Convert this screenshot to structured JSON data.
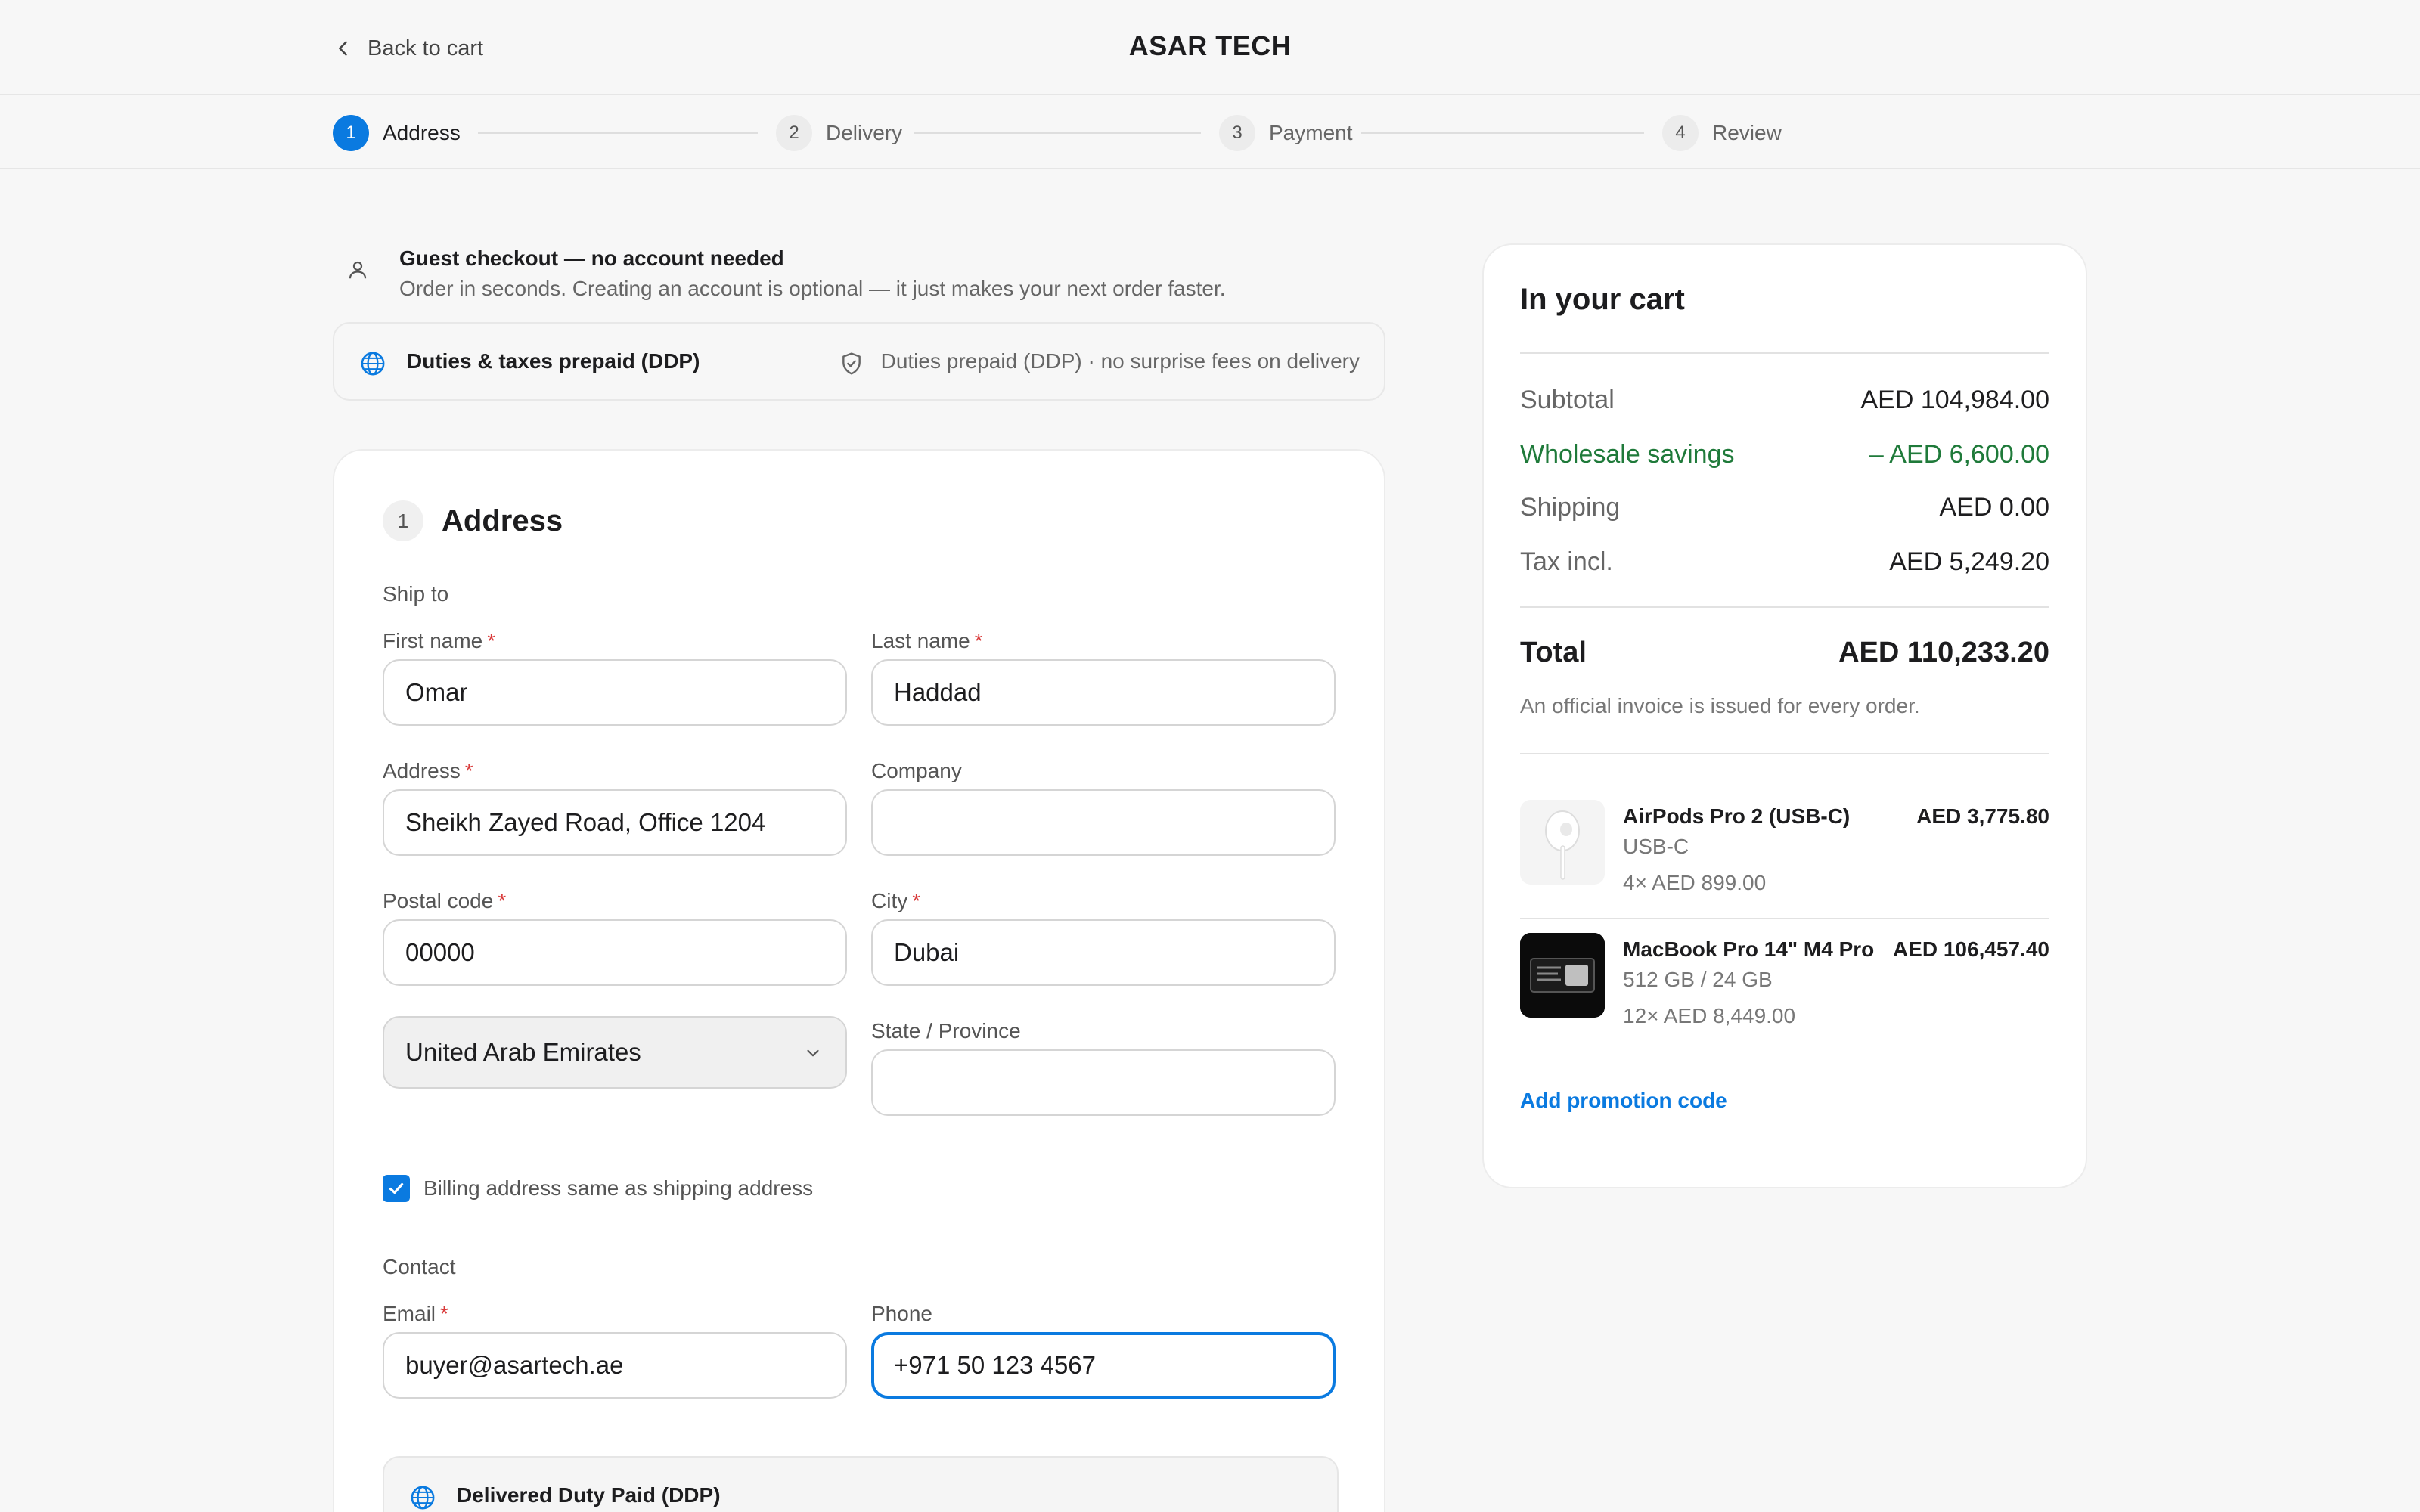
{
  "header": {
    "back_label": "Back to cart",
    "brand": "ASAR TECH"
  },
  "stepper": {
    "steps": [
      {
        "num": "1",
        "label": "Address",
        "active": true
      },
      {
        "num": "2",
        "label": "Delivery",
        "active": false
      },
      {
        "num": "3",
        "label": "Payment",
        "active": false
      },
      {
        "num": "4",
        "label": "Review",
        "active": false
      }
    ]
  },
  "guest": {
    "title": "Guest checkout — no account needed",
    "subtitle": "Order in seconds. Creating an account is optional — it just makes your next order faster."
  },
  "ddp_bar": {
    "title": "Duties & taxes prepaid (DDP)",
    "note": "Duties prepaid (DDP) · no surprise fees on delivery"
  },
  "address": {
    "step_num": "1",
    "title": "Address",
    "ship_to_label": "Ship to",
    "first_name": {
      "label": "First name",
      "value": "Omar"
    },
    "last_name": {
      "label": "Last name",
      "value": "Haddad"
    },
    "address": {
      "label": "Address",
      "value": "Sheikh Zayed Road, Office 1204"
    },
    "company": {
      "label": "Company",
      "value": ""
    },
    "postal_code": {
      "label": "Postal code",
      "value": "00000"
    },
    "city": {
      "label": "City",
      "value": "Dubai"
    },
    "country": {
      "value": "United Arab Emirates"
    },
    "state": {
      "label": "State / Province",
      "value": ""
    },
    "billing_same": {
      "label": "Billing address same as shipping address",
      "checked": true
    },
    "contact_label": "Contact",
    "email": {
      "label": "Email",
      "value": "buyer@asartech.ae"
    },
    "phone": {
      "label": "Phone",
      "value": "+971 50 123 4567"
    },
    "ddp_box_title": "Delivered Duty Paid (DDP)",
    "required_marker": "*"
  },
  "cart": {
    "title": "In your cart",
    "subtotal": {
      "label": "Subtotal",
      "value": "AED 104,984.00"
    },
    "savings": {
      "label": "Wholesale savings",
      "value": "– AED 6,600.00"
    },
    "shipping": {
      "label": "Shipping",
      "value": "AED 0.00"
    },
    "tax": {
      "label": "Tax incl.",
      "value": "AED 5,249.20"
    },
    "total": {
      "label": "Total",
      "value": "AED 110,233.20"
    },
    "invoice_note": "An official invoice is issued for every order.",
    "items": [
      {
        "name": "AirPods Pro 2 (USB-C)",
        "variant": "USB-C",
        "qty": "4× AED 899.00",
        "price": "AED 3,775.80",
        "icon": "airpods-thumbnail"
      },
      {
        "name": "MacBook Pro 14\" M4 Pro",
        "variant": "512 GB / 24 GB",
        "qty": "12× AED 8,449.00",
        "price": "AED 106,457.40",
        "icon": "macbook-thumbnail"
      }
    ],
    "promo_label": "Add promotion code"
  },
  "colors": {
    "accent": "#0a7ae0",
    "savings": "#1f7a3a",
    "required": "#d93a3a"
  }
}
